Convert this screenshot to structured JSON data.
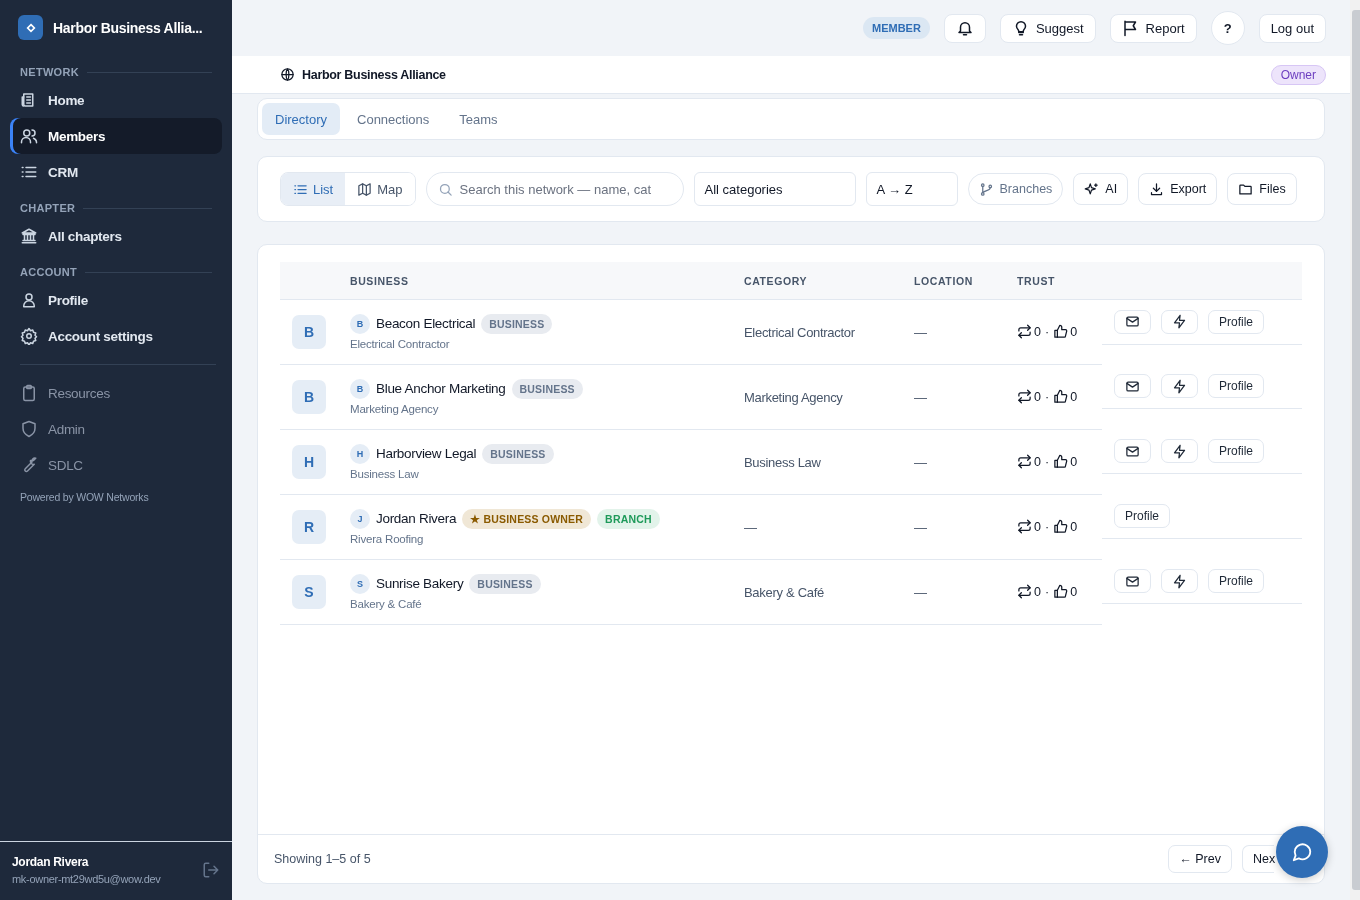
{
  "sidebar": {
    "brand": "Harbor Business Allia...",
    "sections": [
      {
        "heading": "NETWORK",
        "items": [
          {
            "label": "Home",
            "kind": "news",
            "selected": false,
            "disabled": false
          },
          {
            "label": "Members",
            "kind": "users",
            "selected": true,
            "disabled": false
          },
          {
            "label": "CRM",
            "kind": "list",
            "selected": false,
            "disabled": false
          }
        ]
      },
      {
        "heading": "CHAPTER",
        "items": [
          {
            "label": "All chapters",
            "kind": "bank",
            "selected": false,
            "disabled": false
          }
        ]
      },
      {
        "heading": "ACCOUNT",
        "items": [
          {
            "label": "Profile",
            "kind": "user",
            "selected": false,
            "disabled": false
          },
          {
            "label": "Account settings",
            "kind": "gear",
            "selected": false,
            "disabled": false
          }
        ]
      },
      {
        "items": [
          {
            "label": "Resources",
            "kind": "clipboard",
            "selected": false,
            "disabled": true
          },
          {
            "label": "Admin",
            "kind": "shield",
            "selected": false,
            "disabled": true
          },
          {
            "label": "SDLC",
            "kind": "wrench",
            "selected": false,
            "disabled": true
          }
        ]
      }
    ],
    "powered_by": "Powered by WOW Networks",
    "user": {
      "name": "Jordan Rivera",
      "email": "mk-owner-mt29wd5u@wow.dev"
    }
  },
  "top_bar": {
    "role_badge": "MEMBER",
    "buttons": [
      {
        "kind": "bell"
      },
      {
        "kind": "bulb",
        "label": "Suggest"
      },
      {
        "kind": "flag",
        "label": "Report"
      },
      {
        "kind": "round",
        "label": "?"
      },
      {
        "kind": "plain",
        "label": "Log out"
      }
    ]
  },
  "network_bar": {
    "title": "Harbor Business Alliance",
    "role": "Owner"
  },
  "tabs": [
    {
      "label": "Directory",
      "selected": true
    },
    {
      "label": "Connections",
      "selected": false
    },
    {
      "label": "Teams",
      "selected": false
    }
  ],
  "toolbar": {
    "view_toggle": [
      {
        "label": "List",
        "kind": "list",
        "selected": true
      },
      {
        "label": "Map",
        "kind": "map",
        "selected": false
      }
    ],
    "search": {
      "placeholder": "Search this network — name, cat"
    },
    "category_select": "All categories",
    "sort_select": "A → Z",
    "buttons": [
      {
        "label": "Branches",
        "kind": "branch",
        "disabled": true
      },
      {
        "label": "AI",
        "kind": "sparkle",
        "disabled": false
      },
      {
        "label": "Export",
        "kind": "download",
        "disabled": false
      },
      {
        "label": "Files",
        "kind": "folder",
        "disabled": false
      }
    ]
  },
  "table": {
    "columns": [
      "BUSINESS",
      "CATEGORY",
      "LOCATION",
      "TRUST"
    ],
    "rows": [
      {
        "avatar": "B",
        "initial": "B",
        "name": "Beacon Electrical",
        "badges": [
          {
            "kind": "business",
            "label": "BUSINESS"
          }
        ],
        "subtitle": "Electrical Contractor",
        "category": "Electrical Contractor",
        "location": "—",
        "trust": {
          "reposts": "0",
          "sep": "·",
          "likes": "0"
        },
        "actions": [
          {
            "kind": "mail"
          },
          {
            "kind": "bolt"
          },
          {
            "kind": "text",
            "label": "Profile"
          }
        ]
      },
      {
        "avatar": "B",
        "initial": "B",
        "name": "Blue Anchor Marketing",
        "badges": [
          {
            "kind": "business",
            "label": "BUSINESS"
          }
        ],
        "subtitle": "Marketing Agency",
        "category": "Marketing Agency",
        "location": "—",
        "trust": {
          "reposts": "0",
          "sep": "·",
          "likes": "0"
        },
        "actions": [
          {
            "kind": "mail"
          },
          {
            "kind": "bolt"
          },
          {
            "kind": "text",
            "label": "Profile"
          }
        ]
      },
      {
        "avatar": "H",
        "initial": "H",
        "name": "Harborview Legal",
        "badges": [
          {
            "kind": "business",
            "label": "BUSINESS"
          }
        ],
        "subtitle": "Business Law",
        "category": "Business Law",
        "location": "—",
        "trust": {
          "reposts": "0",
          "sep": "·",
          "likes": "0"
        },
        "actions": [
          {
            "kind": "mail"
          },
          {
            "kind": "bolt"
          },
          {
            "kind": "text",
            "label": "Profile"
          }
        ]
      },
      {
        "avatar": "R",
        "initial": "J",
        "name": "Jordan Rivera",
        "badges": [
          {
            "kind": "owner",
            "label": "★ BUSINESS OWNER"
          },
          {
            "kind": "branch",
            "label": "BRANCH"
          }
        ],
        "subtitle": "Rivera Roofing",
        "category": "—",
        "location": "—",
        "trust": {
          "reposts": "0",
          "sep": "·",
          "likes": "0"
        },
        "actions": [
          {
            "kind": "text",
            "label": "Profile"
          }
        ]
      },
      {
        "avatar": "S",
        "initial": "S",
        "name": "Sunrise Bakery",
        "badges": [
          {
            "kind": "business",
            "label": "BUSINESS"
          }
        ],
        "subtitle": "Bakery & Café",
        "category": "Bakery & Café",
        "location": "—",
        "trust": {
          "reposts": "0",
          "sep": "·",
          "likes": "0"
        },
        "actions": [
          {
            "kind": "mail"
          },
          {
            "kind": "bolt"
          },
          {
            "kind": "text",
            "label": "Profile"
          }
        ]
      }
    ]
  },
  "footer": {
    "summary": "Showing 1–5 of 5",
    "prev": "← Prev",
    "next": "Nex"
  }
}
